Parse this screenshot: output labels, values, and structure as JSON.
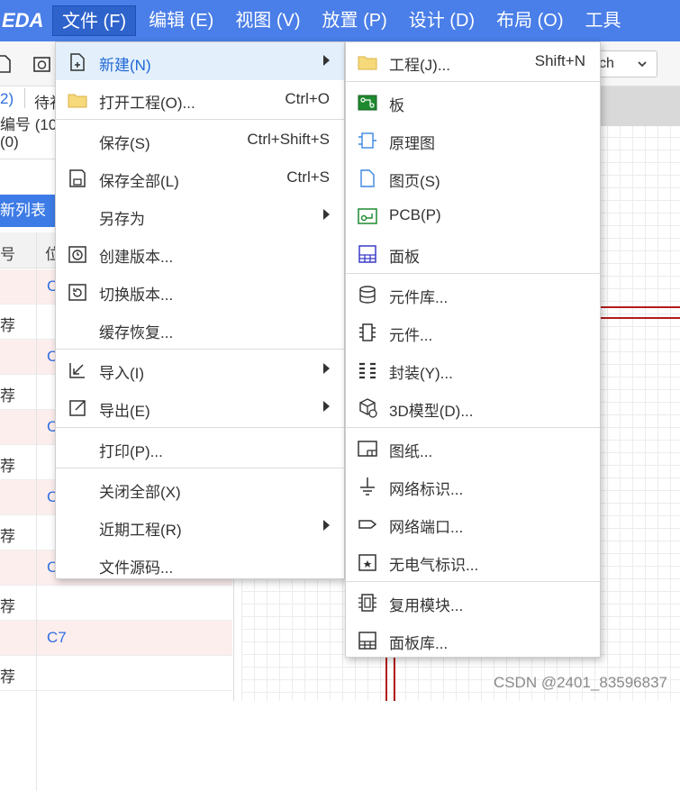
{
  "menubar": {
    "logo": "EDA",
    "items": [
      {
        "label": "文件 (F)"
      },
      {
        "label": "编辑 (E)"
      },
      {
        "label": "视图 (V)"
      },
      {
        "label": "放置 (P)"
      },
      {
        "label": "设计 (D)"
      },
      {
        "label": "布局 (O)"
      },
      {
        "label": "工具"
      }
    ]
  },
  "toolbar": {
    "search_value": "ch"
  },
  "left_panel": {
    "line1_a": "2)",
    "line1_b": "待礼",
    "line2": "编号 (10",
    "line3": "(0)",
    "new_list_btn": "新列表",
    "headers": [
      "号",
      "位"
    ],
    "rows": [
      {
        "c1": "",
        "c2": "C"
      },
      {
        "c1": "荐",
        "c2": ""
      },
      {
        "c1": "",
        "c2": "C"
      },
      {
        "c1": "荐",
        "c2": ""
      },
      {
        "c1": "",
        "c2": "C"
      },
      {
        "c1": "荐",
        "c2": ""
      },
      {
        "c1": "",
        "c2": "C"
      },
      {
        "c1": "荐",
        "c2": ""
      },
      {
        "c1": "",
        "c2": "C"
      },
      {
        "c1": "荐",
        "c2": ""
      },
      {
        "c1": "",
        "c2": "C7"
      },
      {
        "c1": "荐",
        "c2": ""
      }
    ]
  },
  "file_menu": {
    "items": [
      {
        "label": "新建(N)",
        "shortcut": "",
        "icon": "new-file-icon",
        "submenu": true,
        "highlighted": true
      },
      {
        "label": "打开工程(O)...",
        "shortcut": "Ctrl+O",
        "icon": "folder-icon"
      },
      {
        "label": "保存(S)",
        "shortcut": "Ctrl+Shift+S",
        "icon": ""
      },
      {
        "label": "保存全部(L)",
        "shortcut": "Ctrl+S",
        "icon": "save-icon"
      },
      {
        "label": "另存为",
        "shortcut": "",
        "icon": "",
        "submenu": true
      },
      {
        "label": "创建版本...",
        "shortcut": "",
        "icon": "create-version-icon"
      },
      {
        "label": "切换版本...",
        "shortcut": "",
        "icon": "switch-version-icon"
      },
      {
        "label": "缓存恢复...",
        "shortcut": "",
        "icon": ""
      },
      {
        "label": "导入(I)",
        "shortcut": "",
        "icon": "import-icon",
        "submenu": true
      },
      {
        "label": "导出(E)",
        "shortcut": "",
        "icon": "export-icon",
        "submenu": true
      },
      {
        "label": "打印(P)...",
        "shortcut": "",
        "icon": ""
      },
      {
        "label": "关闭全部(X)",
        "shortcut": "",
        "icon": ""
      },
      {
        "label": "近期工程(R)",
        "shortcut": "",
        "icon": "",
        "submenu": true
      },
      {
        "label": "文件源码...",
        "shortcut": "",
        "icon": ""
      }
    ]
  },
  "new_submenu": {
    "items": [
      {
        "label": "工程(J)...",
        "shortcut": "Shift+N",
        "icon": "folder-icon"
      },
      {
        "label": "板",
        "icon": "board-icon"
      },
      {
        "label": "原理图",
        "icon": "schematic-icon"
      },
      {
        "label": "图页(S)",
        "icon": "page-icon"
      },
      {
        "label": "PCB(P)",
        "icon": "pcb-icon"
      },
      {
        "label": "面板",
        "icon": "panel-icon"
      },
      {
        "label": "元件库...",
        "icon": "library-icon"
      },
      {
        "label": "元件...",
        "icon": "component-icon"
      },
      {
        "label": "封装(Y)...",
        "icon": "footprint-icon"
      },
      {
        "label": "3D模型(D)...",
        "icon": "3d-model-icon"
      },
      {
        "label": "图纸...",
        "icon": "drawing-icon"
      },
      {
        "label": "网络标识...",
        "icon": "net-label-icon"
      },
      {
        "label": "网络端口...",
        "icon": "net-port-icon"
      },
      {
        "label": "无电气标识...",
        "icon": "no-electric-icon"
      },
      {
        "label": "复用模块...",
        "icon": "reuse-module-icon"
      },
      {
        "label": "面板库...",
        "icon": "panel-library-icon"
      }
    ]
  },
  "colors": {
    "menubar": "#4a7ee8",
    "highlight_bg": "#e3f0fb",
    "highlight_text": "#1f67d6"
  },
  "watermark": "CSDN @2401_83596837"
}
